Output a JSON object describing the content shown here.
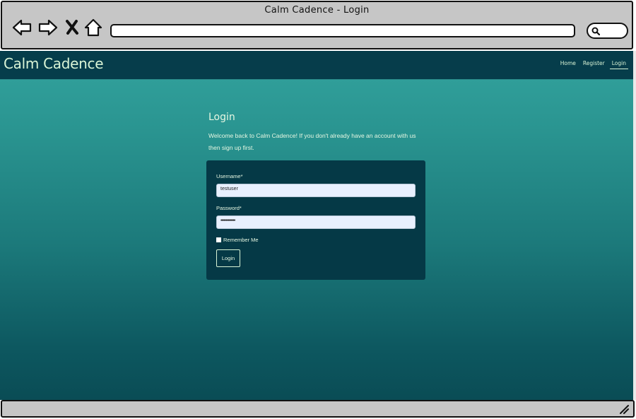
{
  "window": {
    "title": "Calm Cadence - Login"
  },
  "browser": {
    "icons": [
      "back-arrow-icon",
      "forward-arrow-icon",
      "close-x-icon",
      "home-icon",
      "search-icon",
      "resize-grip-icon"
    ],
    "address_value": ""
  },
  "site": {
    "brand": "Calm Cadence",
    "nav": [
      {
        "label": "Home",
        "active": false
      },
      {
        "label": "Register",
        "active": false
      },
      {
        "label": "Login",
        "active": true
      }
    ]
  },
  "login": {
    "title": "Login",
    "intro": "Welcome back to Calm Cadence! If you don't already have an account with us then sign up first.",
    "username_label": "Username*",
    "username_value": "testuser",
    "password_label": "Password*",
    "password_value": "••••••••••••••",
    "remember_label": "Remember Me",
    "submit_label": "Login"
  },
  "colors": {
    "header_bg": "#063d4b",
    "card_bg": "#053946",
    "gradient_top": "#33a39e",
    "gradient_bottom": "#0a4c55",
    "text_light": "#e6f7e2",
    "input_bg": "#e8f0fe"
  }
}
